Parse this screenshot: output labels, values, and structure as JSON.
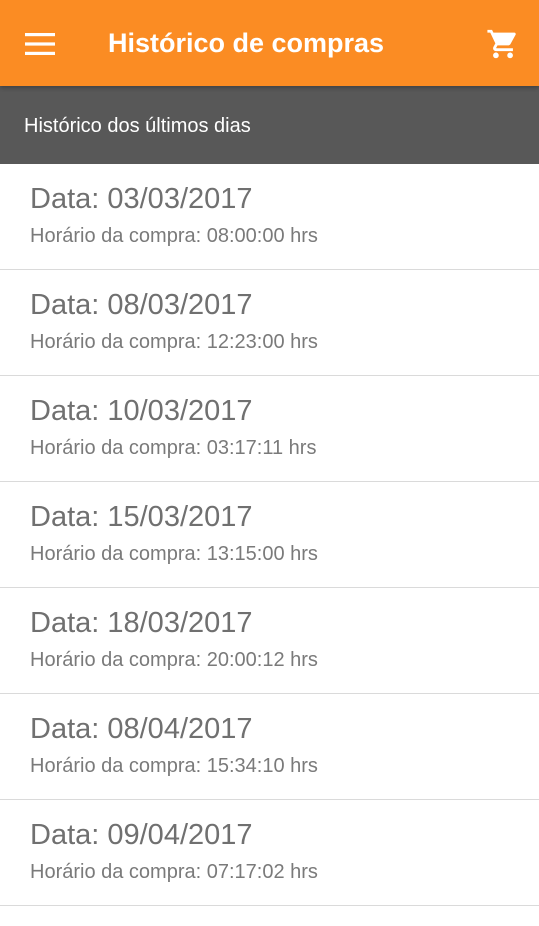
{
  "appbar": {
    "title": "Histórico de compras",
    "menu_icon": "hamburger-menu-icon",
    "cart_icon": "shopping-cart-icon",
    "color": "#fb8c23"
  },
  "subheader": {
    "label": "Histórico dos últimos dias",
    "color": "#585858"
  },
  "purchases": [
    {
      "date": "Data: 03/03/2017",
      "time": "Horário da compra: 08:00:00 hrs"
    },
    {
      "date": "Data: 08/03/2017",
      "time": "Horário da compra: 12:23:00 hrs"
    },
    {
      "date": "Data: 10/03/2017",
      "time": "Horário da compra: 03:17:11 hrs"
    },
    {
      "date": "Data: 15/03/2017",
      "time": "Horário da compra: 13:15:00 hrs"
    },
    {
      "date": "Data: 18/03/2017",
      "time": "Horário da compra: 20:00:12 hrs"
    },
    {
      "date": "Data: 08/04/2017",
      "time": "Horário da compra: 15:34:10 hrs"
    },
    {
      "date": "Data: 09/04/2017",
      "time": "Horário da compra: 07:17:02 hrs"
    }
  ]
}
